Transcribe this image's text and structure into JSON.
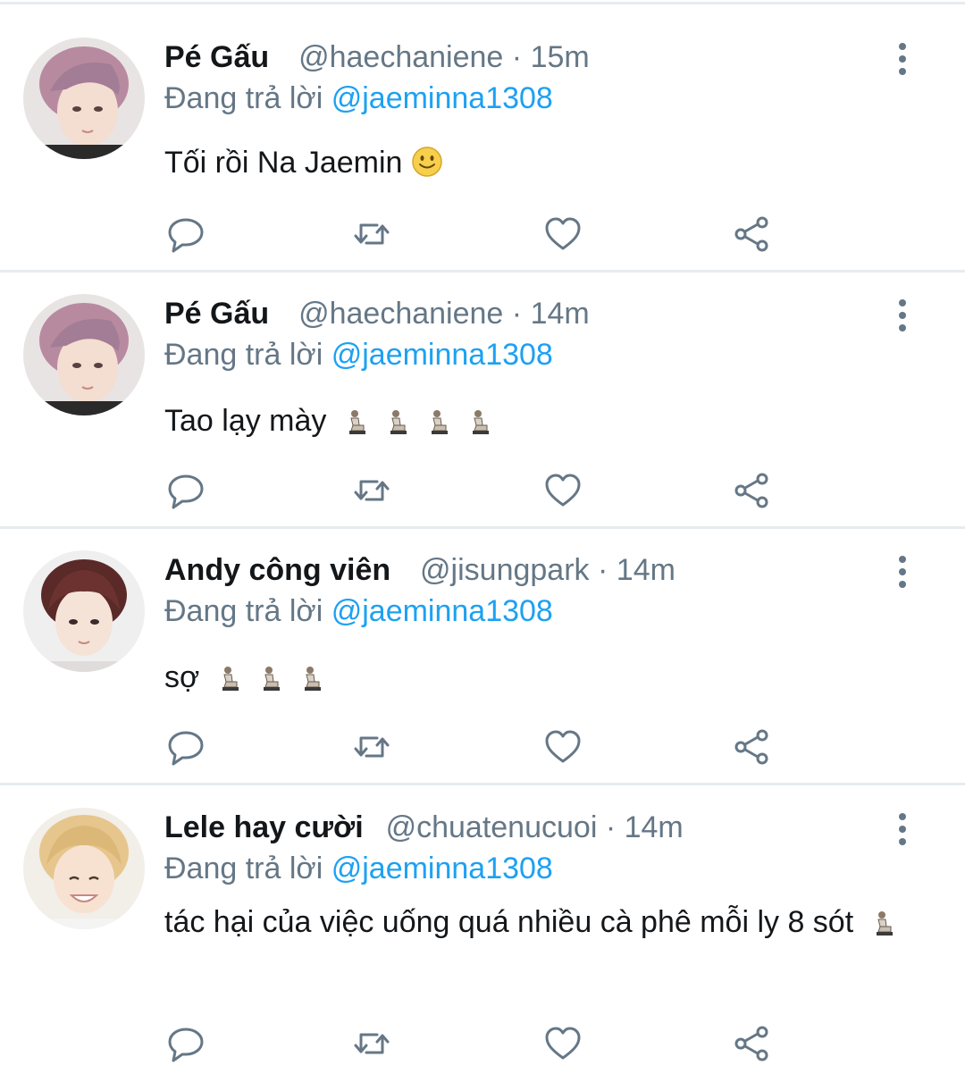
{
  "replying_prefix": "Đang trả lời",
  "tweets": [
    {
      "name": "Pé Gấu",
      "handle": "@haechaniene",
      "separator": "·",
      "time": "15m",
      "reply_to": "@jaeminna1308",
      "text": "Tối rồi Na Jaemin",
      "emoji": "slightly-smiling-face",
      "kneel_count": 0
    },
    {
      "name": "Pé Gấu",
      "handle": "@haechaniene",
      "separator": "·",
      "time": "14m",
      "reply_to": "@jaeminna1308",
      "text": "Tao lạy mày",
      "emoji": "kneeling-person",
      "kneel_count": 4
    },
    {
      "name": "Andy công viên",
      "handle": "@jisungpark",
      "separator": "·",
      "time": "14m",
      "reply_to": "@jaeminna1308",
      "text": "sợ",
      "emoji": "kneeling-person",
      "kneel_count": 3
    },
    {
      "name": "Lele hay cười",
      "handle": "@chuatenucuoi",
      "separator": "·",
      "time": "14m",
      "reply_to": "@jaeminna1308",
      "text": "tác hại của việc uống quá nhiều cà phê mỗi ly 8 sót",
      "emoji": "kneeling-person",
      "kneel_count": 1
    }
  ],
  "icons": {
    "reply": "reply-bubble-icon",
    "retweet": "retweet-icon",
    "like": "heart-icon",
    "share": "share-icon",
    "menu": "more-vertical-icon"
  },
  "colors": {
    "text": "#14171a",
    "muted": "#657786",
    "link": "#1da1f2",
    "separator": "#e6ecf0"
  }
}
